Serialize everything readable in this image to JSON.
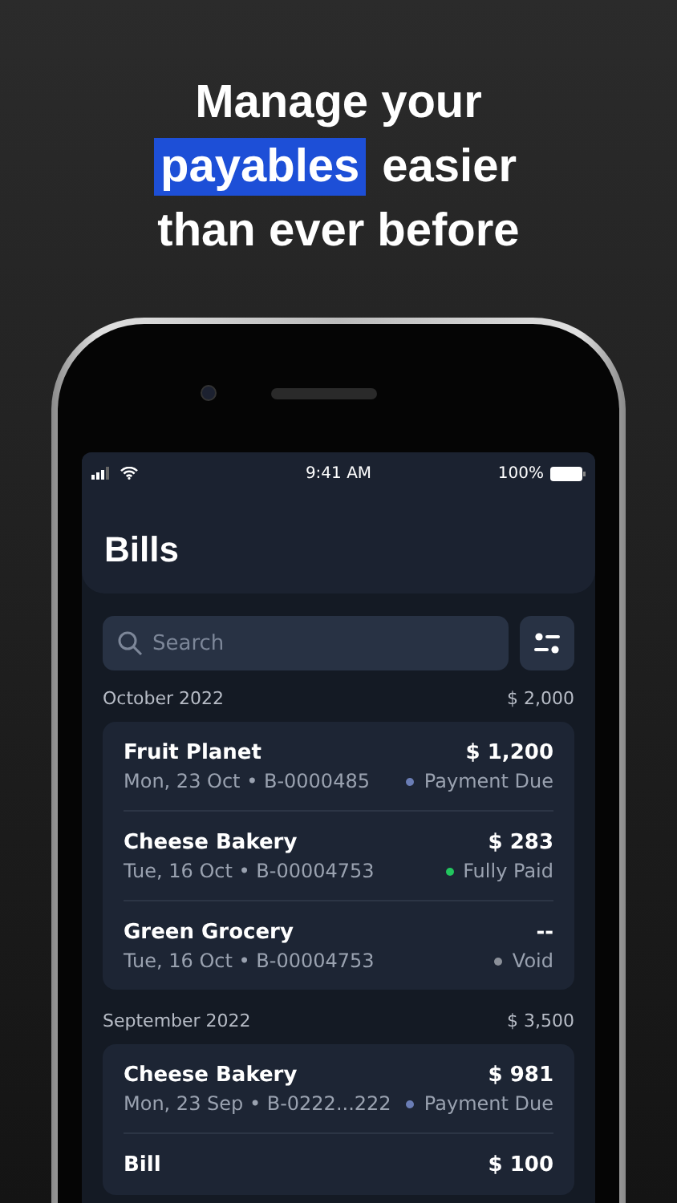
{
  "headline": {
    "lines": [
      {
        "parts": [
          {
            "text": "Manage your",
            "highlighted": false
          }
        ]
      },
      {
        "parts": [
          {
            "text": "payables",
            "highlighted": true
          },
          {
            "text": "easier",
            "highlighted": false
          }
        ]
      },
      {
        "parts": [
          {
            "text": "than ever before",
            "highlighted": false
          }
        ]
      }
    ]
  },
  "status_bar": {
    "time": "9:41 AM",
    "battery": "100%"
  },
  "header": {
    "title": "Bills"
  },
  "search": {
    "placeholder": "Search"
  },
  "groups": [
    {
      "month": "October 2022",
      "total": "$ 2,000",
      "bills": [
        {
          "name": "Fruit Planet",
          "amount": "$ 1,200",
          "details": "Mon, 23 Oct • B-0000485",
          "status": "Payment Due",
          "color": "#6a7db5"
        },
        {
          "name": "Cheese Bakery",
          "amount": "$ 283",
          "details": "Tue, 16 Oct • B-00004753",
          "status": "Fully Paid",
          "color": "#22c55e"
        },
        {
          "name": "Green Grocery",
          "amount": "--",
          "details": "Tue, 16 Oct • B-00004753",
          "status": "Void",
          "color": "#8b9099"
        }
      ]
    },
    {
      "month": "September 2022",
      "total": "$ 3,500",
      "bills": [
        {
          "name": "Cheese Bakery",
          "amount": "$ 981",
          "details": "Mon, 23 Sep • B-0222...222",
          "status": "Payment Due",
          "color": "#6a7db5"
        },
        {
          "name": "Bill",
          "amount": "$ 100"
        }
      ]
    }
  ]
}
